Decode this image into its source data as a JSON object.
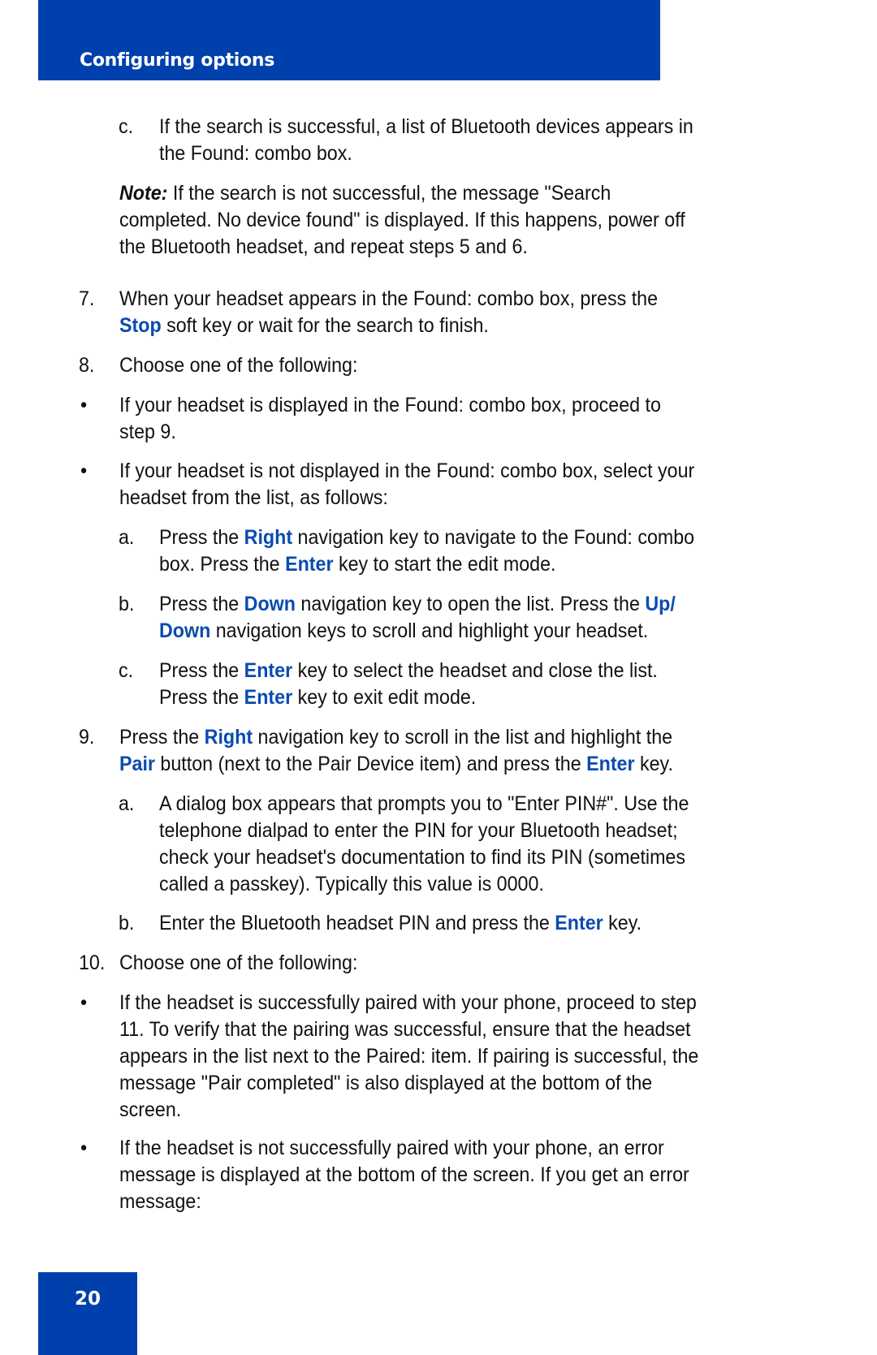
{
  "header": {
    "title": "Configuring options"
  },
  "footer": {
    "page_number": "20"
  },
  "content": {
    "step_6c": {
      "marker": "c.",
      "lines": [
        "If the search is successful, a list of Bluetooth devices appears in",
        "the Found: combo box."
      ]
    },
    "note": {
      "label": "Note:",
      "lines": [
        " If the search is not successful, the message \"Search",
        "completed. No device found\" is displayed. If this happens, power off",
        "the Bluetooth headset, and repeat steps 5 and 6."
      ]
    },
    "step_7": {
      "marker": "7.",
      "line1": "When your headset appears in the Found: combo box, press the",
      "kw_stop": "Stop",
      "line2_rest": " soft key or wait for the search to finish."
    },
    "step_8": {
      "marker": "8.",
      "text": "Choose one of the following:"
    },
    "bullet_8_1": {
      "marker": "•",
      "lines": [
        "If your headset is displayed in the Found: combo box, proceed to",
        "step 9."
      ]
    },
    "bullet_8_2": {
      "marker": "•",
      "lines": [
        "If your headset is not displayed in the Found: combo box, select your",
        "headset from the list, as follows:"
      ]
    },
    "step_8a": {
      "marker": "a.",
      "t1": "Press the ",
      "kw1": "Right",
      "t2": " navigation key to navigate to the Found: combo",
      "t3": "box. Press the ",
      "kw2": "Enter",
      "t4": " key to start the edit mode."
    },
    "step_8b": {
      "marker": "b.",
      "t1": "Press the ",
      "kw1": "Down",
      "t2": " navigation key to open the list. Press the ",
      "kw2": "Up/",
      "kw3": "Down",
      "t3": " navigation keys to scroll and highlight your headset."
    },
    "step_8c": {
      "marker": "c.",
      "t1": "Press the ",
      "kw1": "Enter",
      "t2": " key to select the headset and close the list.",
      "t3": "Press the ",
      "kw2": "Enter",
      "t4": " key to exit edit mode."
    },
    "step_9": {
      "marker": "9.",
      "t1": "Press the ",
      "kw1": "Right",
      "t2": " navigation key to scroll in the list and highlight the",
      "kw2": "Pair",
      "t3": " button (next to the Pair Device item) and press the ",
      "kw3": "Enter",
      "t4": " key."
    },
    "step_9a": {
      "marker": "a.",
      "lines": [
        "A dialog box appears that prompts you to \"Enter PIN#\". Use the",
        "telephone dialpad to enter the PIN for your Bluetooth headset;",
        "check your headset's documentation to find its PIN (sometimes",
        "called a passkey). Typically this value is 0000."
      ]
    },
    "step_9b": {
      "marker": "b.",
      "t1": "Enter the Bluetooth headset PIN and press the ",
      "kw1": "Enter",
      "t2": " key."
    },
    "step_10": {
      "marker": "10.",
      "text": "Choose one of the following:"
    },
    "bullet_10_1": {
      "marker": "•",
      "lines": [
        "If the headset is successfully paired with your phone, proceed to step",
        "11. To verify that the pairing was successful, ensure that the headset",
        "appears in the list next to the Paired: item. If pairing is successful, the",
        "message \"Pair completed\" is also displayed at the bottom of the",
        "screen."
      ]
    },
    "bullet_10_2": {
      "marker": "•",
      "lines": [
        "If the headset is not successfully paired with your phone, an error",
        "message is displayed at the bottom of the screen. If you get an error",
        "message:"
      ]
    }
  }
}
